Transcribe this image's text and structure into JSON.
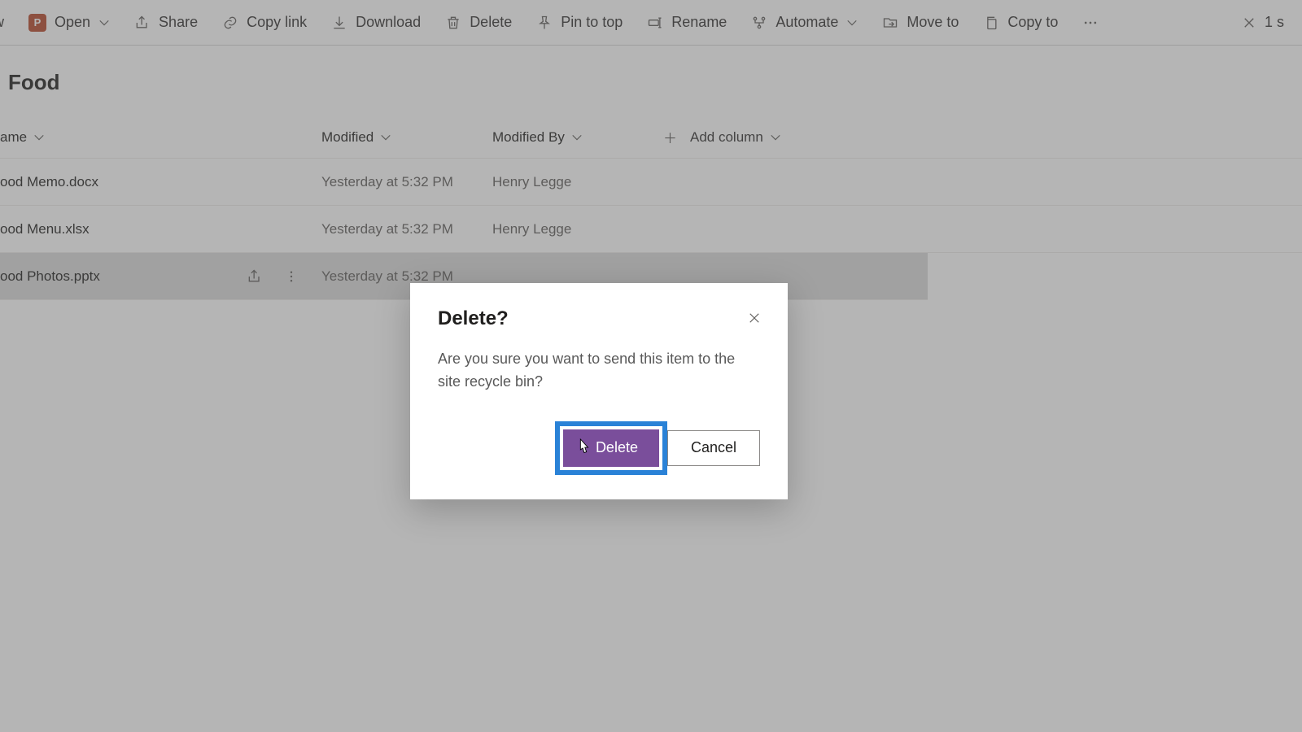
{
  "toolbar": {
    "new_fragment": "w",
    "open": "Open",
    "share": "Share",
    "copy_link": "Copy link",
    "download": "Download",
    "delete": "Delete",
    "pin_to_top": "Pin to top",
    "rename": "Rename",
    "automate": "Automate",
    "move_to": "Move to",
    "copy_to": "Copy to",
    "selection_fragment": "1 s"
  },
  "page": {
    "title": "Food"
  },
  "columns": {
    "name": "ame",
    "modified": "Modified",
    "modified_by": "Modified By",
    "add": "Add column"
  },
  "rows": [
    {
      "name": "ood Memo.docx",
      "modified": "Yesterday at 5:32 PM",
      "by": "Henry Legge",
      "selected": false
    },
    {
      "name": "ood Menu.xlsx",
      "modified": "Yesterday at 5:32 PM",
      "by": "Henry Legge",
      "selected": false
    },
    {
      "name": "ood Photos.pptx",
      "modified": "Yesterday at 5:32 PM",
      "by": "",
      "selected": true
    }
  ],
  "dialog": {
    "title": "Delete?",
    "body": "Are you sure you want to send this item to the site recycle bin?",
    "confirm": "Delete",
    "cancel": "Cancel"
  },
  "icons": {
    "pp_badge": "P"
  }
}
